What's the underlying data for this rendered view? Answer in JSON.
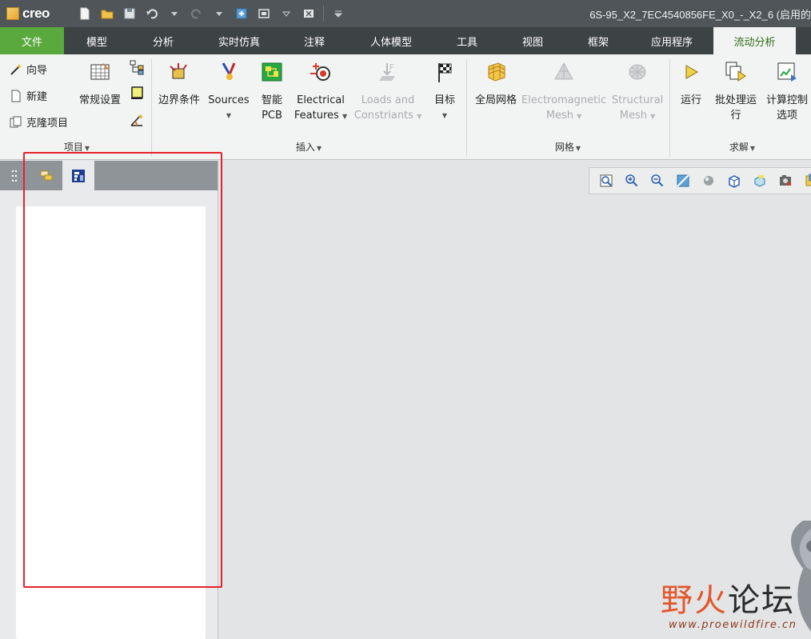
{
  "app": {
    "logo_text": "creo",
    "window_title": "6S-95_X2_7EC4540856FE_X0_-_X2_6 (启用的"
  },
  "quick_access": [
    "new-icon",
    "open-icon",
    "save-icon",
    "undo-icon",
    "redo-icon",
    "regenerate-icon",
    "window-icon",
    "close-window-icon",
    "customize-icon"
  ],
  "tabs": [
    {
      "label": "文件",
      "kind": "file"
    },
    {
      "label": "模型"
    },
    {
      "label": "分析"
    },
    {
      "label": "实时仿真"
    },
    {
      "label": "注释"
    },
    {
      "label": "人体模型"
    },
    {
      "label": "工具"
    },
    {
      "label": "视图"
    },
    {
      "label": "框架"
    },
    {
      "label": "应用程序"
    },
    {
      "label": "流动分析",
      "active": true
    }
  ],
  "ribbon": {
    "project": {
      "label": "项目",
      "wizard": "向导",
      "new": "新建",
      "clone": "克隆项目",
      "general_settings": "常规设置"
    },
    "insert": {
      "label": "插入",
      "boundary_conditions": "边界条件",
      "sources": "Sources",
      "smart_pcb_1": "智能",
      "smart_pcb_2": "PCB",
      "electrical_1": "Electrical",
      "electrical_2": "Features",
      "loads_1": "Loads and",
      "loads_2": "Constriants",
      "goals": "目标"
    },
    "mesh": {
      "label": "网格",
      "global_mesh": "全局网格",
      "em_mesh_1": "Electromagnetic",
      "em_mesh_2": "Mesh",
      "structural_1": "Structural",
      "structural_2": "Mesh"
    },
    "solve": {
      "label": "求解",
      "run": "运行",
      "batch_1": "批处理运",
      "batch_2": "行",
      "calc_1": "计算控制",
      "calc_2": "选项"
    }
  },
  "watermark": {
    "text_a": "野",
    "text_b": "火",
    "text_c": "论坛",
    "url": "www.proewildfire.cn"
  },
  "colors": {
    "file_tab": "#5aa93c",
    "active_tab_text": "#2f6d16",
    "highlight_box": "#e5232b"
  }
}
